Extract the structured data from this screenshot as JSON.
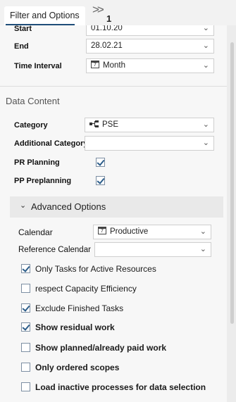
{
  "header": {
    "tab_label": "Filter and Options",
    "more_count": "1"
  },
  "time": {
    "start_label": "Start",
    "start_value": "01.10.20",
    "end_label": "End",
    "end_value": "28.02.21",
    "interval_label": "Time Interval",
    "interval_value": "Month",
    "interval_icon": "calendar-icon"
  },
  "data_content": {
    "section_title": "Data Content",
    "category_label": "Category",
    "category_value": "PSE",
    "category_icon": "hierarchy-icon",
    "additional_category_label": "Additional Category",
    "additional_category_value": "",
    "pr_planning_label": "PR Planning",
    "pr_planning_checked": true,
    "pp_preplanning_label": "PP Preplanning",
    "pp_preplanning_checked": true
  },
  "advanced": {
    "title": "Advanced Options",
    "calendar_label": "Calendar",
    "calendar_value": "Productive",
    "reference_calendar_label": "Reference Calendar",
    "reference_calendar_value": "",
    "options": [
      {
        "label": "Only Tasks for Active Resources",
        "checked": true
      },
      {
        "label": "respect Capacity Efficiency",
        "checked": false
      },
      {
        "label": "Exclude Finished Tasks",
        "checked": true
      },
      {
        "label": "Show residual work",
        "checked": true
      },
      {
        "label": "Show planned/already paid work",
        "checked": false
      },
      {
        "label": "Only ordered scopes",
        "checked": false
      },
      {
        "label": "Load inactive processes for data selection",
        "checked": false
      }
    ]
  },
  "colors": {
    "accent": "#1f4e79",
    "panel_bg": "#f7f7f7",
    "checkbox_border": "#7d8fa3"
  }
}
